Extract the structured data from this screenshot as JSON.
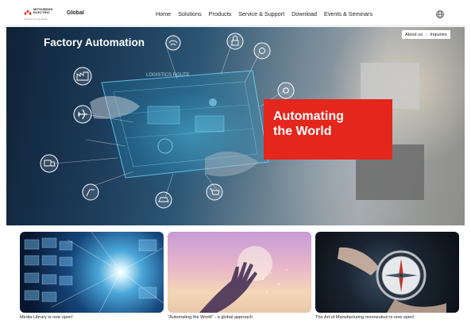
{
  "header": {
    "brand": "MITSUBISHI ELECTRIC",
    "tagline": "Changes for the Better",
    "region": "Global",
    "nav": [
      {
        "label": "Home"
      },
      {
        "label": "Solutions"
      },
      {
        "label": "Products"
      },
      {
        "label": "Service & Support"
      },
      {
        "label": "Download"
      },
      {
        "label": "Events & Seminars"
      }
    ]
  },
  "utility": {
    "about": "About us",
    "inquiries": "Inquiries"
  },
  "hero": {
    "title": "Factory Automation",
    "overlay_text": "LOGISTICS ROUTE",
    "banner_line1": "Automating",
    "banner_line2": "the World"
  },
  "cards": [
    {
      "caption": "Media Library is now open!"
    },
    {
      "caption": "\"Automating the World\" - a global approach"
    },
    {
      "caption": "The Art of Manufacturing monozukuri is now open!"
    }
  ],
  "colors": {
    "accent_red": "#e4261c",
    "header_bg": "#ffffff",
    "hero_dark": "#0f2236"
  },
  "icons": [
    "mitsubishi-diamonds-icon",
    "globe-icon",
    "airplane-icon",
    "truck-icon",
    "factory-icon",
    "gear-icon",
    "lock-icon",
    "car-icon",
    "robot-arm-icon",
    "cart-icon",
    "wifi-icon",
    "camera-icon"
  ]
}
